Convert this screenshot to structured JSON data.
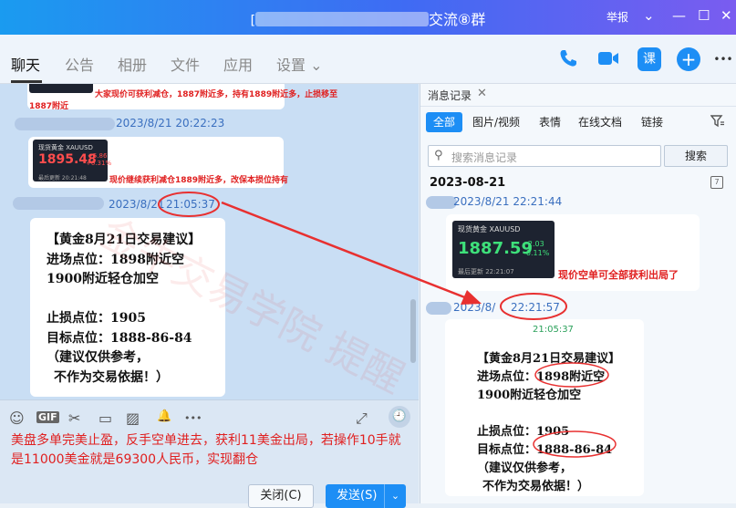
{
  "window": {
    "title_suffix": "交流⑧群",
    "report_label": "举报",
    "controls": {
      "dropdown": "⌄",
      "minimize": "—",
      "maximize": "☐",
      "close": "✕"
    }
  },
  "menu": {
    "tabs": [
      "聊天",
      "公告",
      "相册",
      "文件",
      "应用",
      "设置 ⌄"
    ],
    "class_label": "课",
    "more": "•••"
  },
  "chat": {
    "msg1_text_line1": "大家现价可获利减仓，1887附近多，持有1889附近多，止损移至",
    "msg1_text_line2": "1887附近",
    "ts1": "2023/8/21 20:22:23",
    "quote1": {
      "label": "现货黄金 XAUUSD",
      "price": "1895.48",
      "chg1": "+5.86",
      "chg2": "+0.31%",
      "updated": "最后更新 20:21:48"
    },
    "msg2_text": "现价继续获利减仓1889附近多，改保本损位持有",
    "ts2_date": "2023/8/21",
    "ts2_time": "21:05:37",
    "advice": {
      "title": "【黄金8月21日交易建议】",
      "entry1": "进场点位：1898附近空",
      "entry2": "1900附近轻仓加空",
      "stop": "止损点位：1905",
      "target": "目标点位：1888-86-84",
      "note1": "（建议仅供参考，",
      "note2": "不作为交易依据！）"
    }
  },
  "input": {
    "text": "美盘多单完美止盈，反手空单进去，获利11美金出局，若操作10手就是11000美金就是69300人民币，实现翻仓",
    "close_button": "关闭(C)",
    "send_button": "发送(S)",
    "send_arrow": "⌄",
    "tools": {
      "emoji": "☺",
      "gif": "GIF",
      "scissors": "✂",
      "folder": "▭",
      "image": "▨",
      "bell": "🔔",
      "more": "•••",
      "expand": "⤢",
      "history": "🕘"
    }
  },
  "history": {
    "header": "消息记录",
    "close": "✕",
    "filters": [
      "全部",
      "图片/视频",
      "表情",
      "在线文档",
      "链接"
    ],
    "search_placeholder": "搜索消息记录",
    "search_button": "搜索",
    "date": "2023-08-21",
    "ts1": "2023/8/21 22:21:44",
    "quote": {
      "label": "现货黄金 XAUUSD",
      "price": "1887.59",
      "chg1": "-2.03",
      "chg2": "-0.11%",
      "updated": "最后更新 22:21:07"
    },
    "msg_text": "现价空单可全部获利出局了",
    "ts2_date": "2023/8/",
    "ts2_time": "22:21:57",
    "small_time": "21:05:37",
    "advice": {
      "title": "【黄金8月21日交易建议】",
      "entry1": "进场点位：1898附近空",
      "entry2": "1900附近轻仓加空",
      "stop": "止损点位：1905",
      "target": "目标点位：1888-86-84",
      "note1": "（建议仅供参考，",
      "note2": "不作为交易依据！）"
    }
  },
  "watermark": "金牛交易学院 提醒",
  "colors": {
    "accent": "#1d8ef5",
    "annotation_red": "#e83030"
  }
}
